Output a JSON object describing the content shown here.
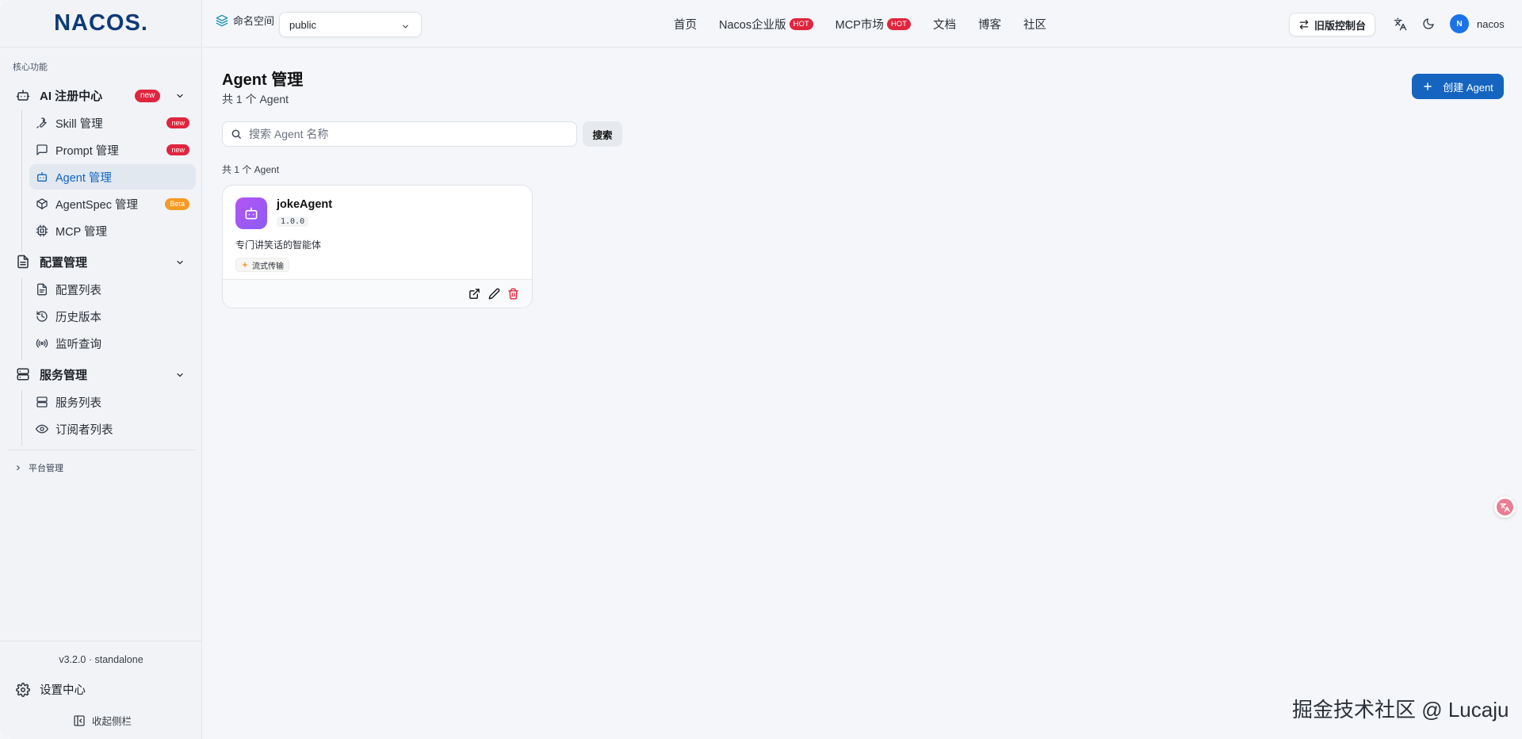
{
  "brand": {
    "logo_text": "NACOS."
  },
  "header": {
    "namespace_label": "命名空间",
    "namespace_value": "public",
    "nav": [
      {
        "label": "首页",
        "badge": ""
      },
      {
        "label": "Nacos企业版",
        "badge": "HOT"
      },
      {
        "label": "MCP市场",
        "badge": "HOT"
      },
      {
        "label": "文档",
        "badge": ""
      },
      {
        "label": "博客",
        "badge": ""
      },
      {
        "label": "社区",
        "badge": ""
      }
    ],
    "old_console_label": "旧版控制台",
    "user_initial": "N",
    "user_name": "nacos"
  },
  "sidebar": {
    "section_label": "核心功能",
    "groups": {
      "ai": {
        "label": "AI 注册中心",
        "badge": "new"
      },
      "config": {
        "label": "配置管理"
      },
      "service": {
        "label": "服务管理"
      }
    },
    "items": {
      "skill": {
        "label": "Skill 管理",
        "badge": "new"
      },
      "prompt": {
        "label": "Prompt 管理",
        "badge": "new"
      },
      "agent": {
        "label": "Agent 管理"
      },
      "agentspec": {
        "label": "AgentSpec 管理",
        "badge": "Beta"
      },
      "mcp": {
        "label": "MCP 管理"
      },
      "config_list": {
        "label": "配置列表"
      },
      "history": {
        "label": "历史版本"
      },
      "listen": {
        "label": "监听查询"
      },
      "service_list": {
        "label": "服务列表"
      },
      "subscriber": {
        "label": "订阅者列表"
      }
    },
    "platform_label": "平台管理",
    "version": "v3.2.0 · standalone",
    "settings_label": "设置中心",
    "collapse_label": "收起侧栏"
  },
  "main": {
    "title": "Agent 管理",
    "subtitle": "共 1 个 Agent",
    "create_label": "创建 Agent",
    "search_placeholder": "搜索 Agent 名称",
    "search_button": "搜索",
    "count_text": "共 1 个 Agent",
    "cards": [
      {
        "name": "jokeAgent",
        "version": "1.0.0",
        "description": "专门讲笑话的智能体",
        "tag": "流式传输"
      }
    ]
  },
  "watermark": "掘金技术社区 @ Lucaju",
  "colors": {
    "accent": "#1565c0",
    "badge_red": "#e0253e",
    "badge_orange": "#f59a23",
    "card_icon": "#a855f7"
  }
}
